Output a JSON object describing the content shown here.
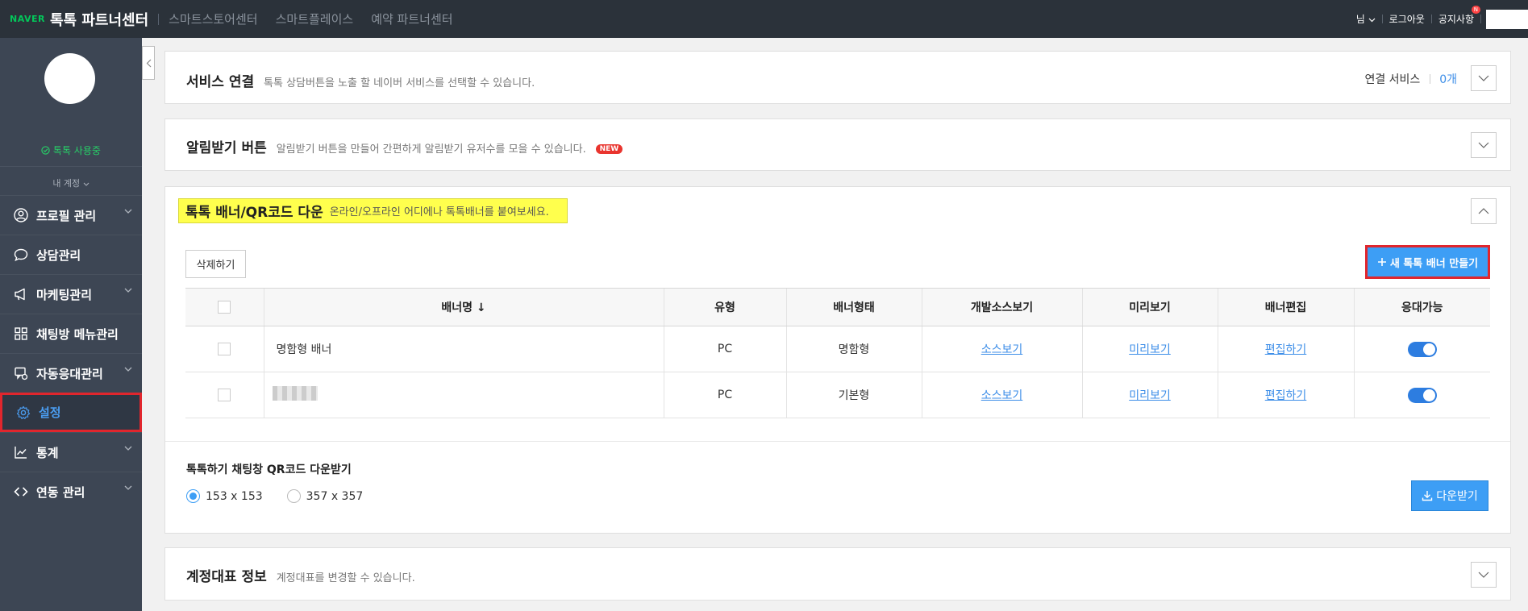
{
  "topbar": {
    "naver": "NAVER",
    "brand": "톡톡 파트너센터",
    "links": [
      "스마트스토어센터",
      "스마트플레이스",
      "예약 파트너센터"
    ],
    "user": "님",
    "logout": "로그아웃",
    "notice": "공지사항",
    "notice_badge": "N"
  },
  "sidebar": {
    "status": "톡톡 사용중",
    "my_account": "내 계정",
    "items": [
      {
        "label": "프로필 관리",
        "icon": "user-circle-icon",
        "has_chevron": true
      },
      {
        "label": "상담관리",
        "icon": "chat-bubble-icon",
        "has_chevron": false
      },
      {
        "label": "마케팅관리",
        "icon": "megaphone-icon",
        "has_chevron": true
      },
      {
        "label": "채팅방 메뉴관리",
        "icon": "grid-icon",
        "has_chevron": false
      },
      {
        "label": "자동응대관리",
        "icon": "auto-reply-icon",
        "has_chevron": true
      },
      {
        "label": "설정",
        "icon": "gear-icon",
        "has_chevron": false,
        "active": true
      },
      {
        "label": "통계",
        "icon": "line-chart-icon",
        "has_chevron": true
      },
      {
        "label": "연동 관리",
        "icon": "code-icon",
        "has_chevron": true
      }
    ]
  },
  "service": {
    "title": "서비스 연결",
    "desc": "톡톡 상담버튼을 노출 할 네이버 서비스를 선택할 수 있습니다.",
    "label": "연결 서비스",
    "count": "0개"
  },
  "notify": {
    "title": "알림받기 버튼",
    "desc": "알림받기 버튼을 만들어 간편하게 알림받기 유저수를 모을 수 있습니다.",
    "badge": "NEW"
  },
  "banner": {
    "title": "톡톡 배너/QR코드 다운",
    "desc": "온라인/오프라인 어디에나 톡톡배너를 붙여보세요.",
    "delete_label": "삭제하기",
    "new_label": "새 톡톡 배너 만들기",
    "columns": [
      "배너명 ↓",
      "유형",
      "배너형태",
      "개발소스보기",
      "미리보기",
      "배너편집",
      "응대가능"
    ],
    "rows": [
      {
        "name": "명함형 배너",
        "type": "PC",
        "form": "명함형",
        "source": "소스보기",
        "preview": "미리보기",
        "edit": "편집하기",
        "enabled": true
      },
      {
        "name": "",
        "type": "PC",
        "form": "기본형",
        "source": "소스보기",
        "preview": "미리보기",
        "edit": "편집하기",
        "enabled": true
      }
    ],
    "qr_title": "톡톡하기 채팅창 QR코드 다운받기",
    "qr_options": [
      "153 x 153",
      "357 x 357"
    ],
    "qr_selected": "153 x 153",
    "download_label": "다운받기"
  },
  "account_rep": {
    "title": "계정대표 정보",
    "desc": "계정대표를 변경할 수 있습니다."
  },
  "colors": {
    "accent": "#3d9ef5",
    "highlight": "#ffff4d",
    "active_border": "#e1262d",
    "sidebar": "#3d4654"
  }
}
